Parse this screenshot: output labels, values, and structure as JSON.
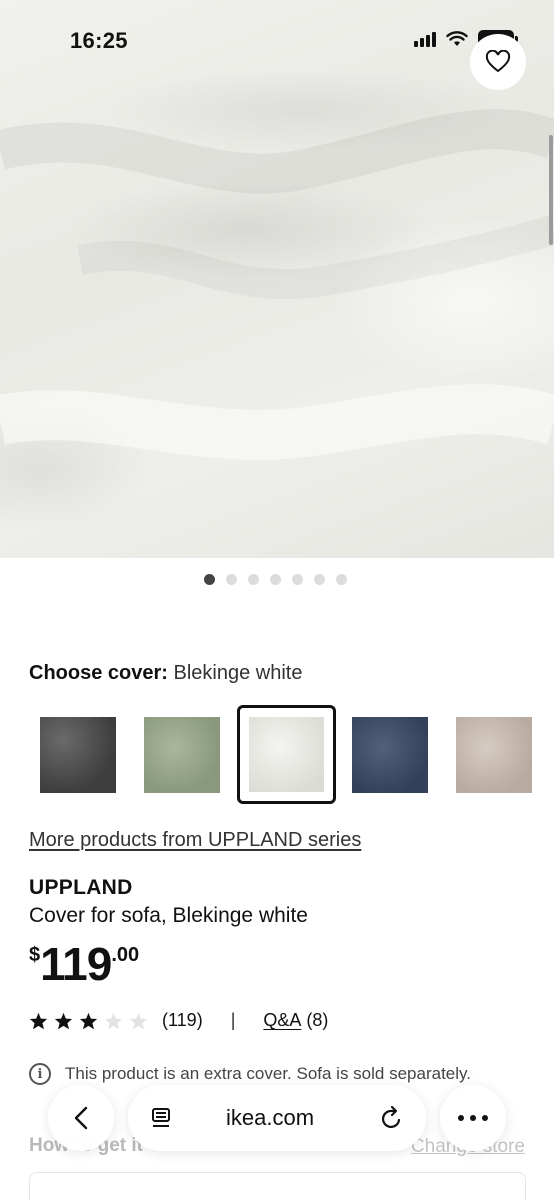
{
  "status_bar": {
    "time": "16:25",
    "battery": "48"
  },
  "product_images": {
    "count": 7,
    "active_index": 0
  },
  "cover": {
    "label": "Choose cover:",
    "selected_name": "Blekinge white",
    "swatches": [
      {
        "name": "dark-grey",
        "color": "#4b4b4b"
      },
      {
        "name": "light-green",
        "color": "#9aa88c"
      },
      {
        "name": "white",
        "color": "#ececE7",
        "selected": true
      },
      {
        "name": "blue",
        "color": "#3d4b63"
      },
      {
        "name": "beige",
        "color": "#c9bdb3"
      }
    ]
  },
  "series_link": "More products from UPPLAND series",
  "product": {
    "brand": "UPPLAND",
    "description": "Cover for sofa, Blekinge white",
    "price": {
      "currency": "$",
      "integer": "119",
      "decimal": ".00"
    }
  },
  "rating": {
    "stars": 3,
    "max_stars": 5,
    "count": "(119)",
    "separator": "|",
    "qa_label": "Q&A",
    "qa_count": "(8)"
  },
  "info_text": "This product is an extra cover. Sofa is sold separately.",
  "delivery": {
    "heading": "How to get it",
    "change_store": "Change store"
  },
  "browser": {
    "url": "ikea.com"
  },
  "colors": {
    "accent": "#111111",
    "star_filled": "#111111",
    "star_empty": "#e3e3e3"
  }
}
